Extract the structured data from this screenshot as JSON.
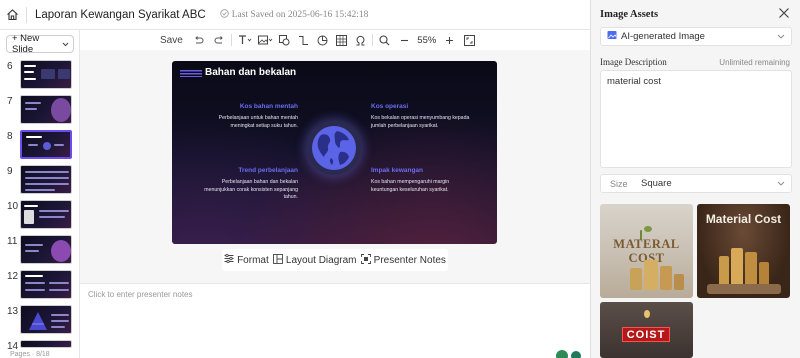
{
  "header": {
    "doc_title": "Laporan Kewangan Syarikat ABC",
    "saved_status": "Last Saved on 2025-06-16 15:42:18"
  },
  "sidebar": {
    "new_slide_label": "+ New Slide",
    "slides": [
      {
        "num": "6"
      },
      {
        "num": "7"
      },
      {
        "num": "8"
      },
      {
        "num": "9"
      },
      {
        "num": "10"
      },
      {
        "num": "11"
      },
      {
        "num": "12"
      },
      {
        "num": "13"
      }
    ],
    "footer": "Pages · 8/18"
  },
  "toolbar": {
    "save_label": "Save",
    "zoom": "55%"
  },
  "slide": {
    "title": "Bahan dan bekalan",
    "sections": [
      {
        "heading": "Kos bahan mentah",
        "body": "Perbelanjaan untuk bahan mentah meningkat setiap suku tahun."
      },
      {
        "heading": "Kos operasi",
        "body": "Kos bekalan operasi menyumbang kepada jumlah perbelanjaan syarikat."
      },
      {
        "heading": "Trend perbelanjaan",
        "body": "Perbelanjaan bahan dan bekalan menunjukkan corak konsisten sepanjang tahun."
      },
      {
        "heading": "Impak kewangan",
        "body": "Kos bahan mempengaruhi margin keuntungan keseluruhan syarikat."
      }
    ]
  },
  "canvas_tools": {
    "format": "Format",
    "layout_diagram": "Layout Diagram",
    "presenter_notes": "Presenter Notes"
  },
  "notes": {
    "placeholder": "Click to enter presenter notes"
  },
  "right_panel": {
    "title": "Image Assets",
    "generator": "AI-generated Image",
    "description_label": "Image Description",
    "limit": "Unlimited remaining",
    "description_value": "material cost",
    "size_label": "Size",
    "size_value": "Square",
    "assets": [
      {
        "text": "MATERAL COST"
      },
      {
        "text": "Material Cost"
      },
      {
        "text": "COIST"
      }
    ]
  },
  "colors": {
    "accent": "#6a4df0",
    "slide_heading": "#6c6cf0"
  }
}
